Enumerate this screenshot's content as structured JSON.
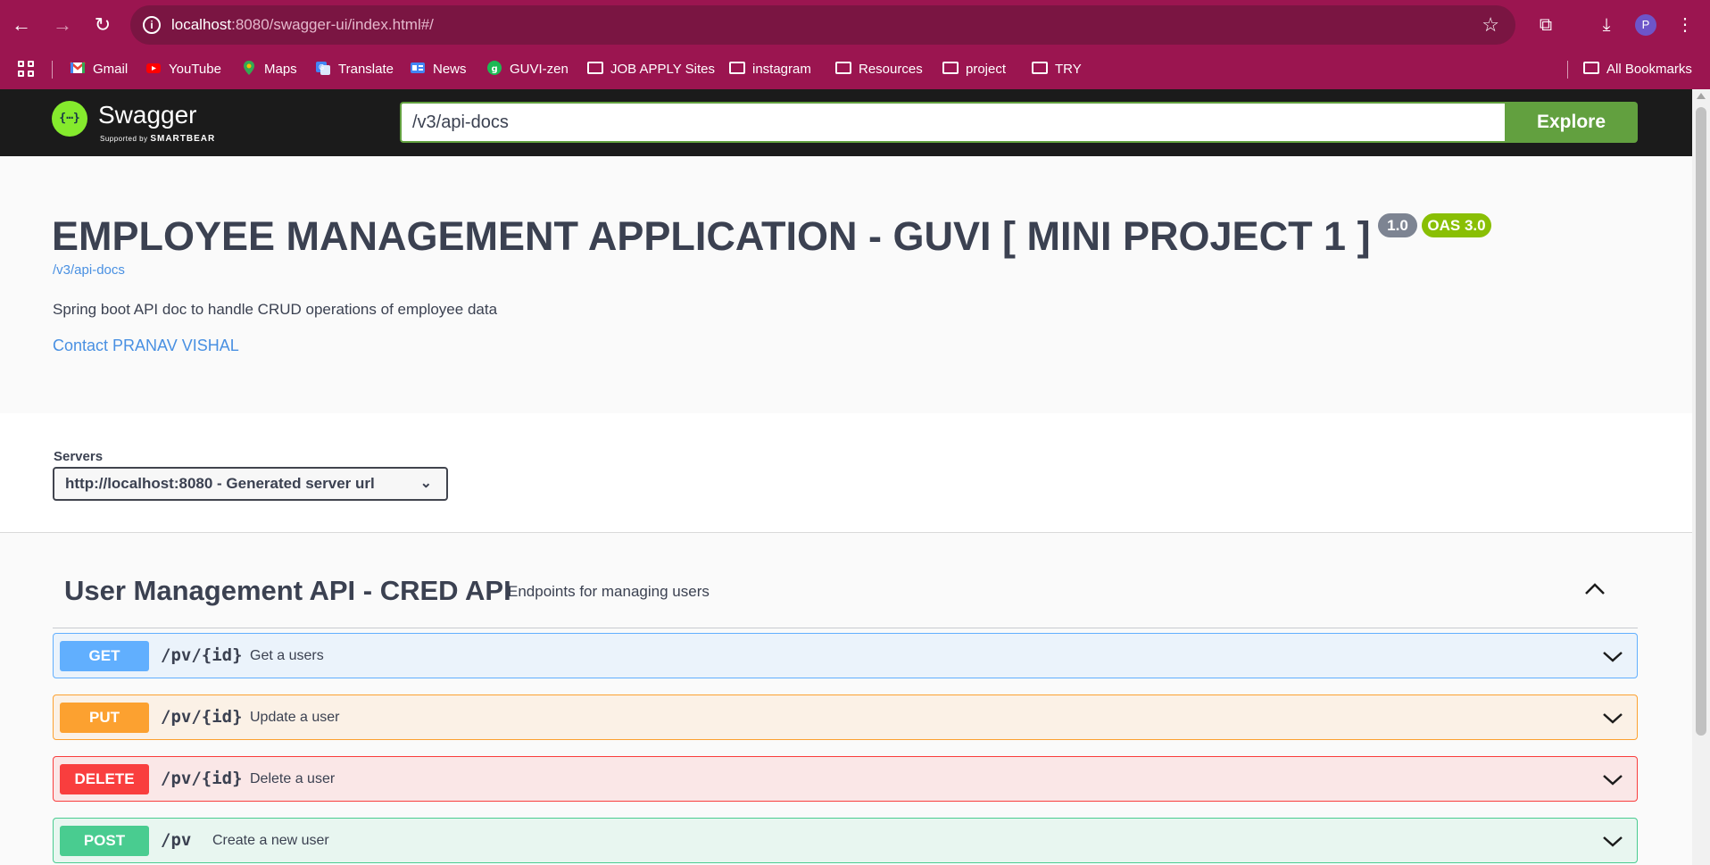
{
  "browser": {
    "url_host": "localhost",
    "url_rest": ":8080/swagger-ui/index.html#/",
    "avatar_letter": "P"
  },
  "bookmarks": {
    "items": [
      {
        "label": "Gmail",
        "icon": "gmail-icon"
      },
      {
        "label": "YouTube",
        "icon": "youtube-icon"
      },
      {
        "label": "Maps",
        "icon": "maps-icon"
      },
      {
        "label": "Translate",
        "icon": "translate-icon"
      },
      {
        "label": "News",
        "icon": "news-icon"
      },
      {
        "label": "GUVI-zen",
        "icon": "guvi-icon"
      },
      {
        "label": "JOB APPLY Sites",
        "icon": "folder-icon"
      },
      {
        "label": "instagram",
        "icon": "folder-icon"
      },
      {
        "label": "Resources",
        "icon": "folder-icon"
      },
      {
        "label": "project",
        "icon": "folder-icon"
      },
      {
        "label": "TRY",
        "icon": "folder-icon"
      }
    ],
    "all_bookmarks": "All Bookmarks"
  },
  "topbar": {
    "logo_text": "Swagger",
    "logo_sub_prefix": "Supported by",
    "logo_sub_brand": "SMARTBEAR",
    "explore_value": "/v3/api-docs",
    "explore_label": "Explore"
  },
  "info": {
    "title": "EMPLOYEE MANAGEMENT APPLICATION - GUVI [ MINI PROJECT 1 ]",
    "version": "1.0",
    "oas": "OAS 3.0",
    "spec_link": "/v3/api-docs",
    "description": "Spring boot API doc to handle CRUD operations of employee data",
    "contact": "Contact PRANAV VISHAL"
  },
  "servers": {
    "label": "Servers",
    "selected": "http://localhost:8080 - Generated server url"
  },
  "tag": {
    "name": "User Management API - CRED API",
    "description": "Endpoints for managing users"
  },
  "operations": [
    {
      "method": "GET",
      "path": "/pv/{id}",
      "summary": "Get a users"
    },
    {
      "method": "PUT",
      "path": "/pv/{id}",
      "summary": "Update a user"
    },
    {
      "method": "DELETE",
      "path": "/pv/{id}",
      "summary": "Delete a user"
    },
    {
      "method": "POST",
      "path": "/pv",
      "summary": "Create a new user"
    }
  ],
  "colors": {
    "chrome": "#9b1550",
    "get": "#61affe",
    "put": "#fca130",
    "delete": "#f93e3e",
    "post": "#49cc90",
    "swagger_green": "#62a03f"
  }
}
